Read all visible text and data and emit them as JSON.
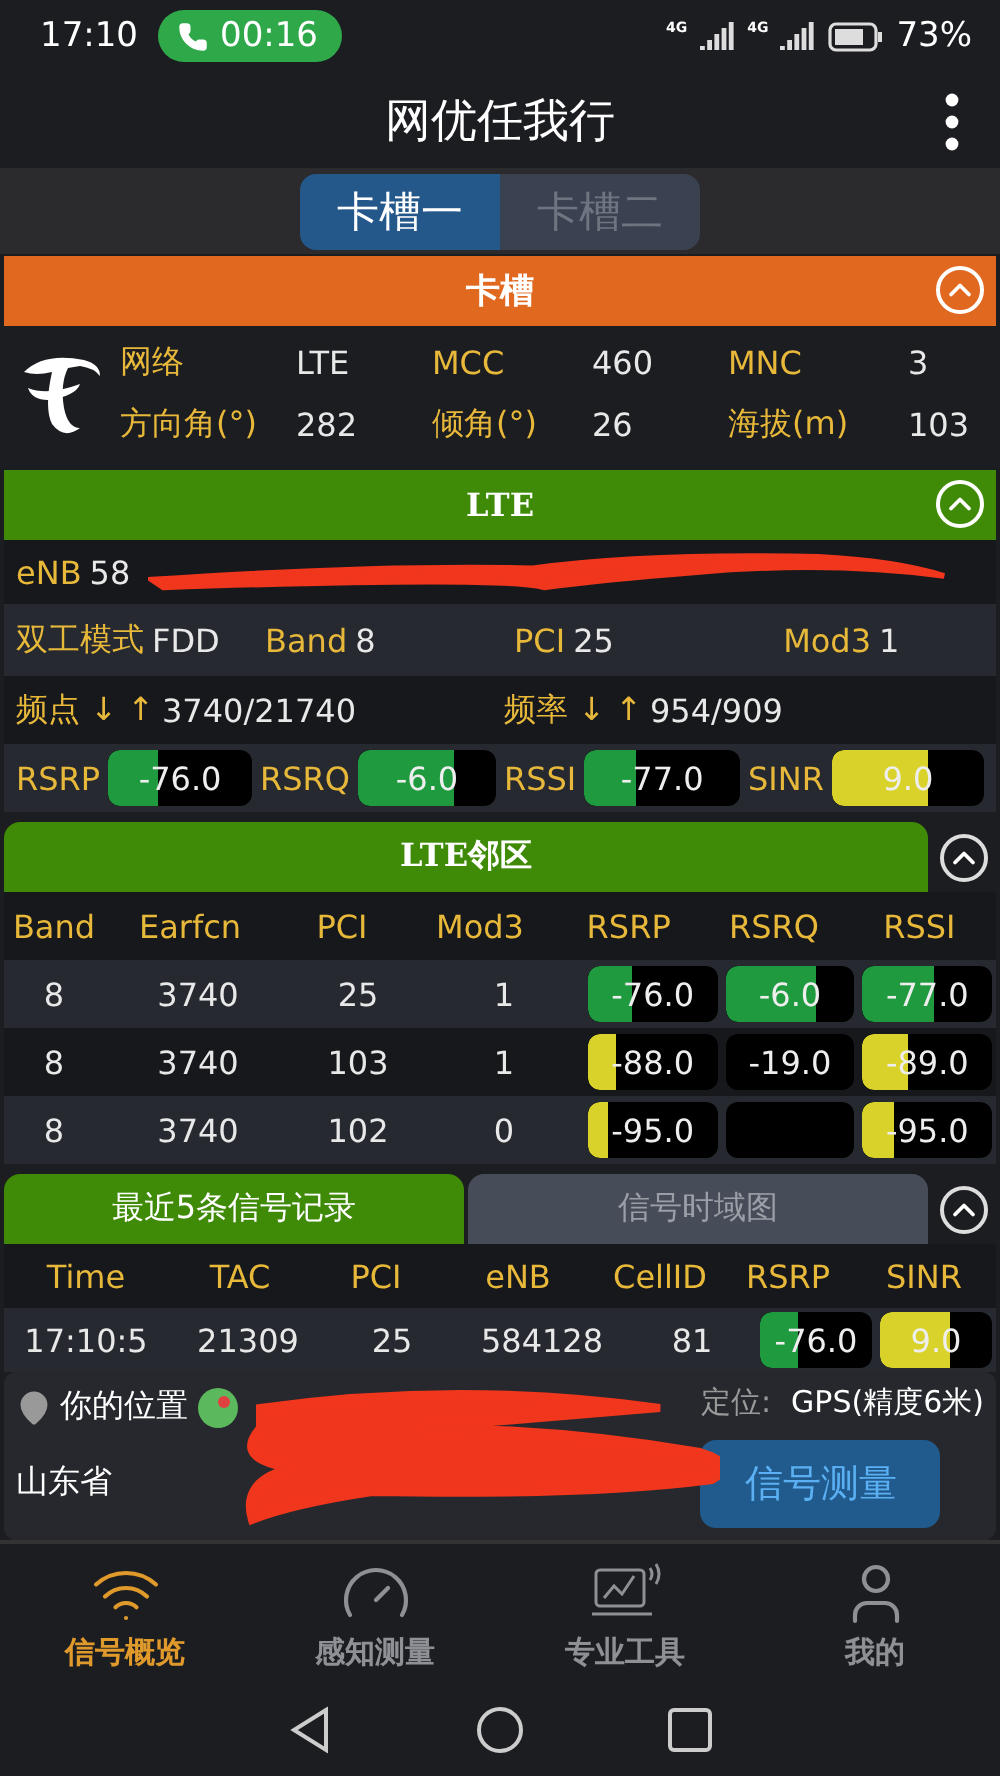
{
  "status_bar": {
    "time": "17:10",
    "call_timer": "00:16",
    "signals": [
      {
        "label": "4G"
      },
      {
        "label": "4G"
      }
    ],
    "battery": "73%"
  },
  "header": {
    "title": "网优任我行"
  },
  "sim_tabs": [
    {
      "label": "卡槽一",
      "selected": true
    },
    {
      "label": "卡槽二",
      "selected": false
    }
  ],
  "sim_section": {
    "title": "卡槽",
    "fields": [
      {
        "label": "网络",
        "value": "LTE"
      },
      {
        "label": "MCC",
        "value": "460"
      },
      {
        "label": "MNC",
        "value": "3"
      },
      {
        "label": "方向角(°)",
        "value": "282"
      },
      {
        "label": "倾角(°)",
        "value": "26"
      },
      {
        "label": "海拔(m)",
        "value": "103"
      }
    ]
  },
  "lte_section": {
    "title": "LTE",
    "enb_label": "eNB",
    "enb_value": "58",
    "params": [
      {
        "label": "双工模式",
        "value": "FDD"
      },
      {
        "label": "Band",
        "value": "8"
      },
      {
        "label": "PCI",
        "value": "25"
      },
      {
        "label": "Mod3",
        "value": "1"
      }
    ],
    "freq": [
      {
        "label": "频点 ↓ ↑",
        "value": "3740/21740"
      },
      {
        "label": "频率 ↓ ↑",
        "value": "954/909"
      }
    ],
    "meters": [
      {
        "label": "RSRP",
        "reading": "-76.0",
        "level": 0.34,
        "color": "#1f9a3e"
      },
      {
        "label": "RSRQ",
        "reading": "-6.0",
        "level": 0.7,
        "color": "#1f9a3e"
      },
      {
        "label": "RSSI",
        "reading": "-77.0",
        "level": 0.33,
        "color": "#1f9a3e"
      },
      {
        "label": "SINR",
        "reading": "9.0",
        "level": 0.63,
        "color": "#d8d22a"
      }
    ]
  },
  "neighbors": {
    "title": "LTE邻区",
    "columns": [
      "Band",
      "Earfcn",
      "PCI",
      "Mod3",
      "RSRP",
      "RSRQ",
      "RSSI"
    ],
    "rows": [
      {
        "cells": [
          "8",
          "3740",
          "25",
          "1"
        ],
        "meters": [
          {
            "kind": "bar",
            "reading": "-76.0",
            "level": 0.34,
            "color": "#1f9a3e"
          },
          {
            "kind": "bar",
            "reading": "-6.0",
            "level": 0.7,
            "color": "#1f9a3e"
          },
          {
            "kind": "bar",
            "reading": "-77.0",
            "level": 0.55,
            "color": "#1f9a3e"
          }
        ]
      },
      {
        "cells": [
          "8",
          "3740",
          "103",
          "1"
        ],
        "meters": [
          {
            "kind": "bar",
            "reading": "-88.0",
            "level": 0.22,
            "color": "#d8d22a"
          },
          {
            "kind": "bar",
            "reading": "-19.0"
          },
          {
            "kind": "bar",
            "reading": "-89.0",
            "level": 0.35,
            "color": "#d8d22a"
          }
        ]
      },
      {
        "cells": [
          "8",
          "3740",
          "102",
          "0"
        ],
        "meters": [
          {
            "kind": "bar",
            "reading": "-95.0",
            "level": 0.15,
            "color": "#d8d22a"
          },
          {
            "kind": "blank"
          },
          {
            "kind": "bar",
            "reading": "-95.0",
            "level": 0.25,
            "color": "#d8d22a"
          }
        ]
      }
    ]
  },
  "records": {
    "tabs": [
      {
        "label": "最近5条信号记录",
        "selected": true
      },
      {
        "label": "信号时域图",
        "selected": false
      }
    ],
    "columns": [
      "Time",
      "TAC",
      "PCI",
      "eNB",
      "CellID",
      "RSRP",
      "SINR"
    ],
    "rows": [
      {
        "cells": [
          "17:10:5",
          "21309",
          "25",
          "584128",
          "81"
        ],
        "meters": [
          {
            "reading": "-76.0",
            "level": 0.34,
            "color": "#1f9a3e"
          },
          {
            "reading": "9.0",
            "level": 0.63,
            "color": "#d8d22a"
          }
        ]
      }
    ]
  },
  "location": {
    "label": "你的位置",
    "fix_label": "定位:",
    "fix_value": "GPS(精度6米)",
    "address": "山东省",
    "button": "信号测量"
  },
  "bottom_nav": [
    {
      "label": "信号概览",
      "selected": true
    },
    {
      "label": "感知测量",
      "selected": false
    },
    {
      "label": "专业工具",
      "selected": false
    },
    {
      "label": "我的",
      "selected": false
    }
  ]
}
